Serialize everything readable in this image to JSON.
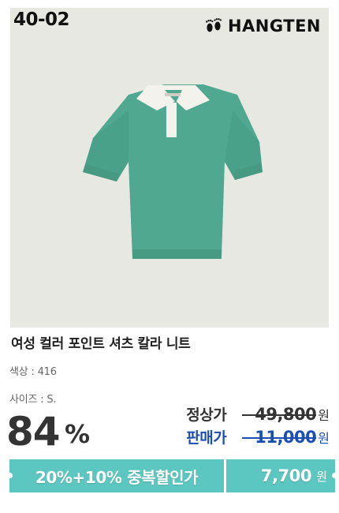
{
  "product": {
    "code": "40-02",
    "brand": "HANGTEN",
    "title": "여성 컬러 포인트 셔츠 칼라 니트",
    "color_label": "색상 : 416",
    "size_label": "사이즈 : S."
  },
  "pricing": {
    "discount_percent": "84",
    "percent_sign": "%",
    "regular_label": "정상가",
    "regular_price": "49,800",
    "sale_label": "판매가",
    "sale_price": "11,000",
    "currency": "원"
  },
  "banner": {
    "promo_text": "20%+10% 중복할인가",
    "final_price": "7,700",
    "currency": "원"
  },
  "colors": {
    "background": "#e8e8e3",
    "accent_teal": "#5bc7c0",
    "sale_blue": "#1b4fb3",
    "shirt_green": "#4fa88f",
    "collar_white": "#f4f2ec"
  },
  "icons": {
    "brand_logo": "footprints-icon"
  }
}
